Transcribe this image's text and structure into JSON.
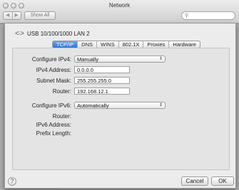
{
  "window": {
    "title": "Network",
    "show_all": "Show All",
    "search_placeholder": ""
  },
  "interface": {
    "name": "USB 10/100/1000 LAN 2"
  },
  "tabs": [
    {
      "label": "TCP/IP",
      "active": true
    },
    {
      "label": "DNS"
    },
    {
      "label": "WINS"
    },
    {
      "label": "802.1X"
    },
    {
      "label": "Proxies"
    },
    {
      "label": "Hardware"
    }
  ],
  "ipv4": {
    "configure_label": "Configure IPv4:",
    "configure_value": "Manually",
    "address_label": "IPv4 Address:",
    "address_value": "0.0.0.0",
    "mask_label": "Subnet Mask:",
    "mask_value": "255.255.255.0",
    "router_label": "Router:",
    "router_value": "192.168.12.1"
  },
  "ipv6": {
    "configure_label": "Configure IPv6:",
    "configure_value": "Automatically",
    "router_label": "Router:",
    "address_label": "IPv6 Address:",
    "prefix_label": "Prefix Length:"
  },
  "buttons": {
    "help": "?",
    "cancel": "Cancel",
    "ok": "OK"
  },
  "icons": {
    "network": "network-arrows-icon",
    "popup_caret": "updown-caret-icon",
    "search": "magnifier-icon"
  },
  "colors": {
    "active_tab": "#2f74d6"
  }
}
